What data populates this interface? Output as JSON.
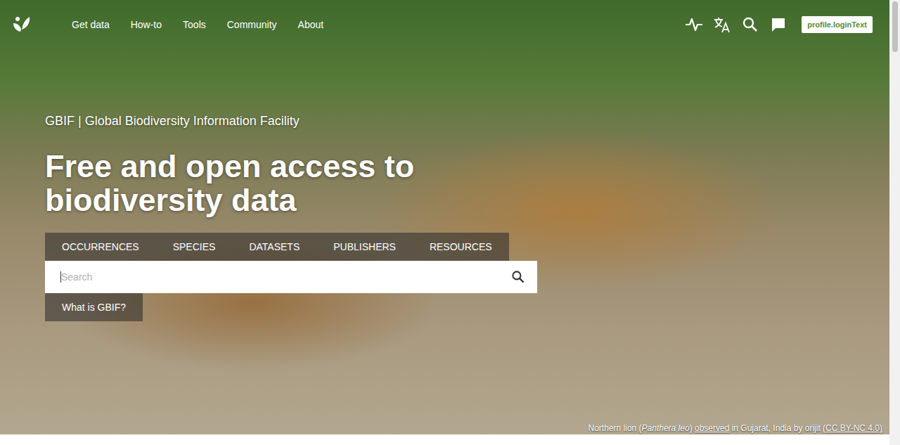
{
  "header": {
    "nav": [
      {
        "label": "Get data"
      },
      {
        "label": "How-to"
      },
      {
        "label": "Tools"
      },
      {
        "label": "Community"
      },
      {
        "label": "About"
      }
    ],
    "login": "profile.loginText"
  },
  "hero": {
    "site_name": "GBIF | Global Biodiversity Information Facility",
    "headline": "Free and open access to biodiversity data",
    "search_tabs": [
      {
        "label": "OCCURRENCES",
        "selected": false
      },
      {
        "label": "SPECIES",
        "selected": false
      },
      {
        "label": "DATASETS",
        "selected": false
      },
      {
        "label": "PUBLISHERS",
        "selected": false
      },
      {
        "label": "RESOURCES",
        "selected": false
      }
    ],
    "search": {
      "placeholder": "Search"
    },
    "about_button": "What is GBIF?"
  },
  "photo_credit": [
    {
      "text": "Northern lion (",
      "kind": "plain"
    },
    {
      "text": "Panthera leo",
      "kind": "italic"
    },
    {
      "text": ") ",
      "kind": "plain"
    },
    {
      "text": "observed",
      "kind": "link"
    },
    {
      "text": " in Gujarat, India by orijit ",
      "kind": "plain"
    },
    {
      "text": "(CC BY-NC 4.0)",
      "kind": "link"
    }
  ]
}
